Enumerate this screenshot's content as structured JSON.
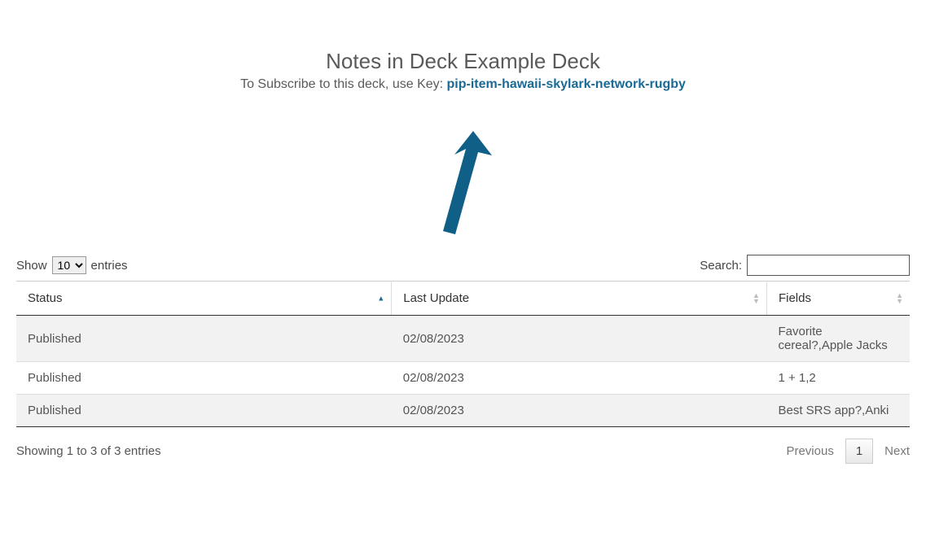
{
  "header": {
    "title": "Notes in Deck Example Deck",
    "subscribe_prefix": "To Subscribe to this deck, use Key: ",
    "subscribe_key": "pip-item-hawaii-skylark-network-rugby"
  },
  "controls": {
    "show_label_before": "Show",
    "show_label_after": "entries",
    "show_value": "10",
    "search_label": "Search:",
    "search_value": ""
  },
  "table": {
    "columns": {
      "status": "Status",
      "last_update": "Last Update",
      "fields": "Fields"
    },
    "sort": {
      "column": "status",
      "dir": "asc"
    },
    "rows": [
      {
        "status": "Published",
        "last_update": "02/08/2023",
        "fields": "Favorite cereal?,Apple Jacks"
      },
      {
        "status": "Published",
        "last_update": "02/08/2023",
        "fields": "1 + 1,2"
      },
      {
        "status": "Published",
        "last_update": "02/08/2023",
        "fields": "Best SRS app?,Anki"
      }
    ]
  },
  "footer": {
    "info": "Showing 1 to 3 of 3 entries",
    "prev": "Previous",
    "next": "Next",
    "pages": [
      "1"
    ]
  }
}
